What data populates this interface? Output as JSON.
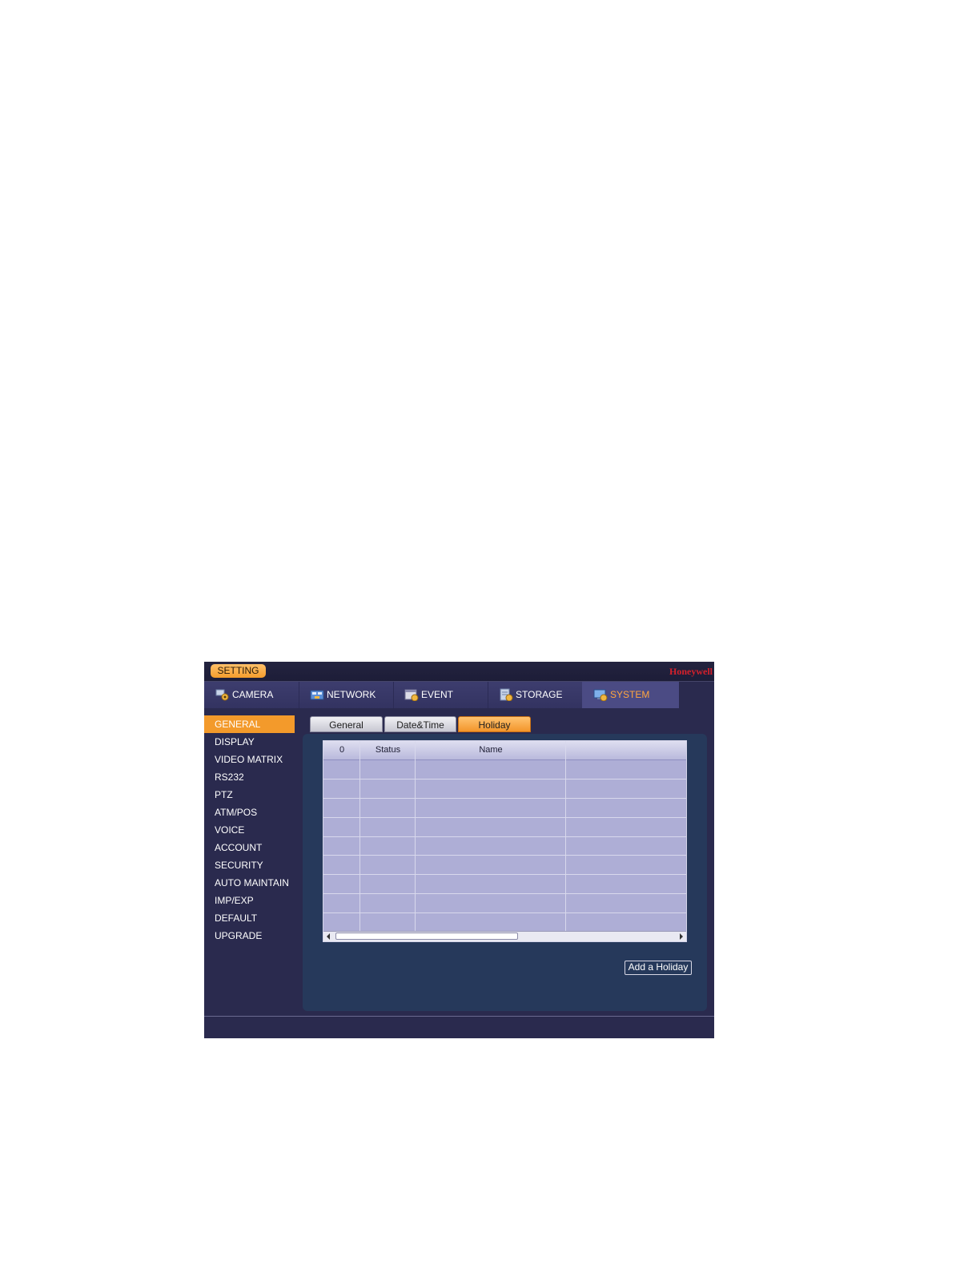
{
  "titlebar": {
    "setting_label": "SETTING",
    "brand": "Honeywell"
  },
  "main_tabs": [
    {
      "label": "CAMERA",
      "icon": "camera-gear-icon",
      "active": false
    },
    {
      "label": "NETWORK",
      "icon": "network-icon",
      "active": false
    },
    {
      "label": "EVENT",
      "icon": "event-icon",
      "active": false
    },
    {
      "label": "STORAGE",
      "icon": "storage-icon",
      "active": false
    },
    {
      "label": "SYSTEM",
      "icon": "system-icon",
      "active": true
    }
  ],
  "side_menu": [
    {
      "label": "GENERAL",
      "active": true
    },
    {
      "label": "DISPLAY"
    },
    {
      "label": "VIDEO MATRIX"
    },
    {
      "label": "RS232"
    },
    {
      "label": "PTZ"
    },
    {
      "label": "ATM/POS"
    },
    {
      "label": "VOICE"
    },
    {
      "label": "ACCOUNT"
    },
    {
      "label": "SECURITY"
    },
    {
      "label": "AUTO MAINTAIN"
    },
    {
      "label": "IMP/EXP"
    },
    {
      "label": "DEFAULT"
    },
    {
      "label": "UPGRADE"
    }
  ],
  "sub_tabs": [
    {
      "label": "General",
      "active": false
    },
    {
      "label": "Date&Time",
      "active": false
    },
    {
      "label": "Holiday",
      "active": true
    }
  ],
  "holiday_table": {
    "columns": [
      "0",
      "Status",
      "Name",
      ""
    ],
    "rows": []
  },
  "actions": {
    "add_holiday": "Add a Holiday"
  },
  "colors": {
    "accent": "#f39a2b",
    "brand": "#d6202b",
    "background": "#2a2a4e"
  }
}
